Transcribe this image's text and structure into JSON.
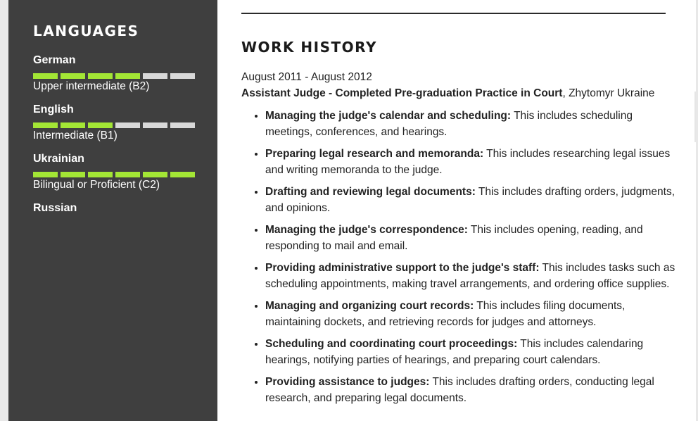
{
  "sidebar": {
    "heading": "LANGUAGES",
    "languages": [
      {
        "name": "German",
        "level": "Upper intermediate (B2)",
        "rating": 4,
        "max": 6
      },
      {
        "name": "English",
        "level": "Intermediate (B1)",
        "rating": 3,
        "max": 6
      },
      {
        "name": "Ukrainian",
        "level": "Bilingual or Proficient (C2)",
        "rating": 6,
        "max": 6
      },
      {
        "name": "Russian",
        "level": "",
        "rating": null,
        "max": 6
      }
    ],
    "colors": {
      "background": "#3f3f3f",
      "bar_on": "#a3e635",
      "bar_off": "#d8d8d8"
    }
  },
  "main": {
    "section_title": "WORK HISTORY",
    "job": {
      "dates": "August 2011 - August 2012",
      "title": "Assistant Judge - Completed Pre-graduation Practice in Court",
      "location": ", Zhytomyr Ukraine",
      "duties": [
        {
          "head": "Managing the judge's calendar and scheduling:",
          "text": " This includes scheduling meetings, conferences, and hearings."
        },
        {
          "head": "Preparing legal research and memoranda:",
          "text": " This includes researching legal issues and writing memoranda to the judge."
        },
        {
          "head": "Drafting and reviewing legal documents:",
          "text": " This includes drafting orders, judgments, and opinions."
        },
        {
          "head": "Managing the judge's correspondence:",
          "text": " This includes opening, reading, and responding to mail and email."
        },
        {
          "head": "Providing administrative support to the judge's staff:",
          "text": " This includes tasks such as scheduling appointments, making travel arrangements, and ordering office supplies."
        },
        {
          "head": "Managing and organizing court records:",
          "text": " This includes filing documents, maintaining dockets, and retrieving records for judges and attorneys."
        },
        {
          "head": "Scheduling and coordinating court proceedings:",
          "text": " This includes calendaring hearings, notifying parties of hearings, and preparing court calendars."
        },
        {
          "head": "Providing assistance to judges:",
          "text": " This includes drafting orders, conducting legal research, and preparing legal documents."
        }
      ]
    }
  }
}
